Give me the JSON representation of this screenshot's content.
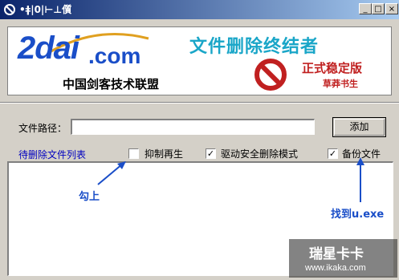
{
  "window": {
    "title": "•ǂ|0|⊢⊥儨",
    "min_label": "_",
    "max_label": "□",
    "close_label": "×"
  },
  "banner": {
    "logo_main": "2dai",
    "logo_suffix": ".com",
    "logo_subtitle": "中国剑客技术联盟",
    "title": "文件删除终结者",
    "edition": "正式稳定版",
    "author": "草莽书生"
  },
  "form": {
    "path_label": "文件路径：",
    "path_value": "",
    "add_button": "添加",
    "list_caption": "待删除文件列表",
    "options": [
      {
        "label": "抑制再生",
        "checked": false
      },
      {
        "label": "驱动安全删除模式",
        "checked": true
      },
      {
        "label": "备份文件",
        "checked": true
      }
    ]
  },
  "annotations": {
    "check_hint": "勾上",
    "find_hint": "找到u.exe"
  },
  "watermark": {
    "main": "瑞星卡卡",
    "url": "www.ikaka.com"
  },
  "colors": {
    "titlebar": "#0a246a",
    "annotation": "#1a4ec8",
    "banner_title": "#1aa6c8",
    "edition": "#c02020"
  }
}
